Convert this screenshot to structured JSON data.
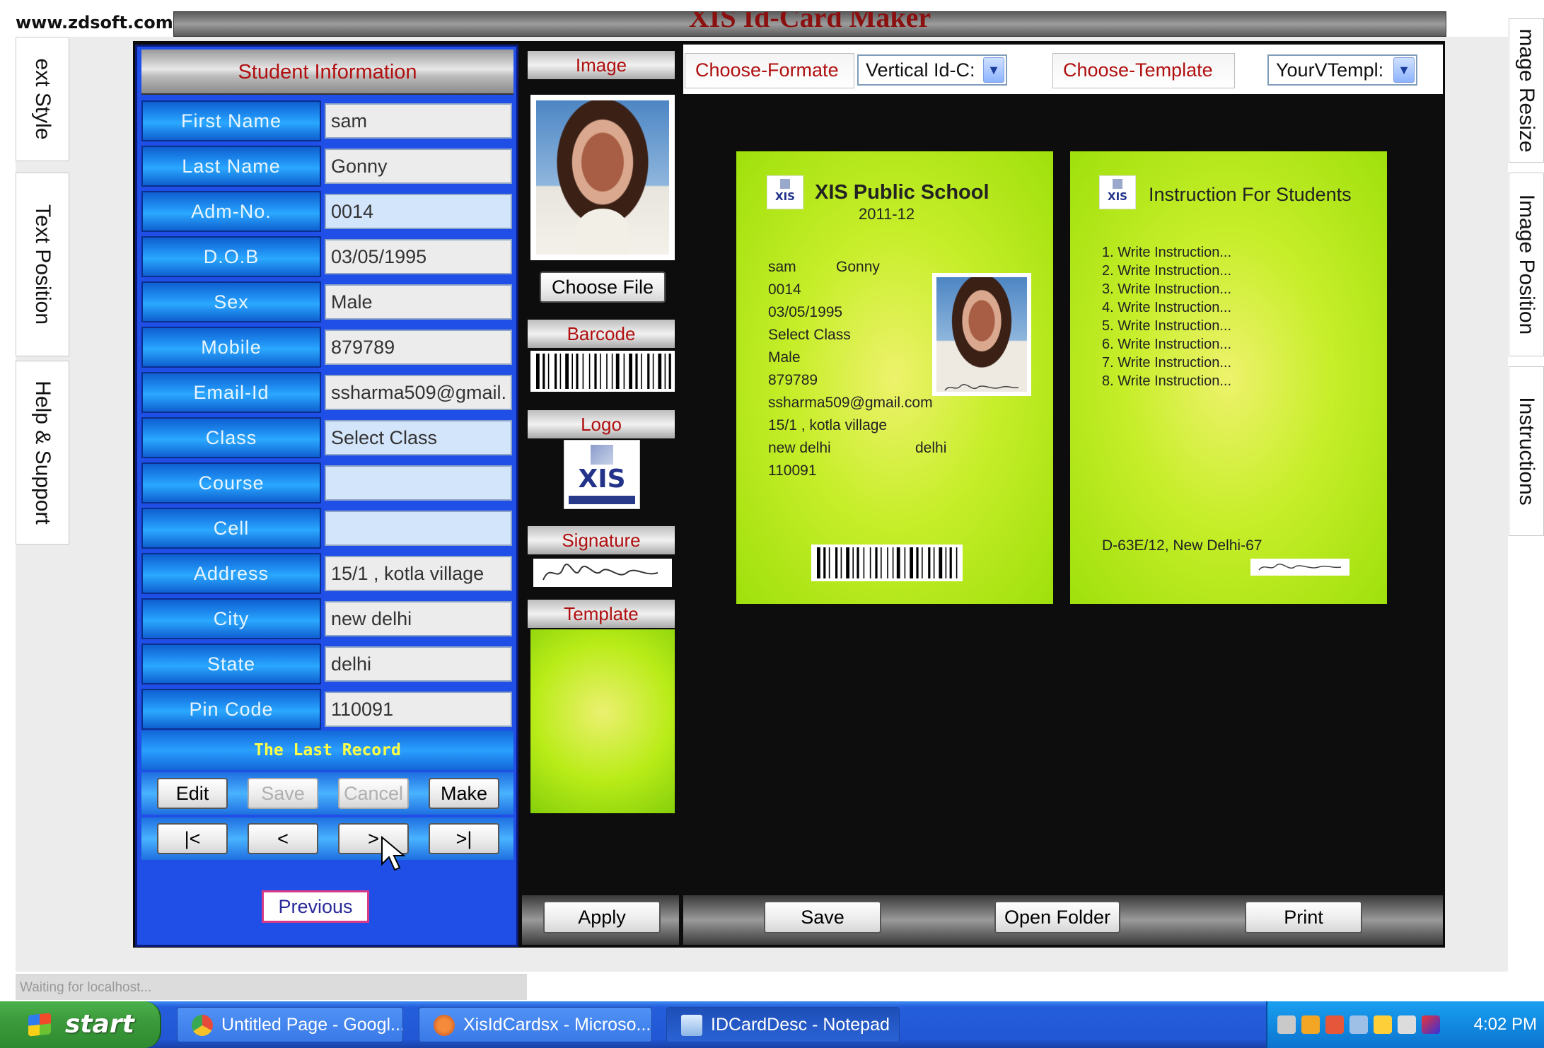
{
  "browser": {
    "url": "www.zdsoft.com",
    "status_text": "Waiting for localhost..."
  },
  "app": {
    "title": "XIS Id-Card Maker"
  },
  "side_tabs": {
    "left": [
      "ext Style",
      "Text Position",
      "Help & Support"
    ],
    "right": [
      "mage Resize",
      "Image Position",
      "Instructions"
    ]
  },
  "student_panel": {
    "header": "Student Information",
    "fields": [
      {
        "label": "First Name",
        "value": "sam",
        "highlight": false
      },
      {
        "label": "Last Name",
        "value": "Gonny",
        "highlight": false
      },
      {
        "label": "Adm-No.",
        "value": "0014",
        "highlight": true
      },
      {
        "label": "D.O.B",
        "value": "03/05/1995",
        "highlight": false
      },
      {
        "label": "Sex",
        "value": "Male",
        "highlight": false
      },
      {
        "label": "Mobile",
        "value": "879789",
        "highlight": false
      },
      {
        "label": "Email-Id",
        "value": "ssharma509@gmail.",
        "highlight": false
      },
      {
        "label": "Class",
        "value": "Select Class",
        "highlight": true
      },
      {
        "label": "Course",
        "value": "",
        "highlight": true
      },
      {
        "label": "Cell",
        "value": "",
        "highlight": true
      },
      {
        "label": "Address",
        "value": "15/1 , kotla village",
        "highlight": false
      },
      {
        "label": "City",
        "value": "new delhi",
        "highlight": false
      },
      {
        "label": "State",
        "value": "delhi",
        "highlight": false
      },
      {
        "label": "Pin Code",
        "value": "110091",
        "highlight": false
      }
    ],
    "record_status": "The Last Record",
    "action_buttons": {
      "edit": "Edit",
      "save": "Save",
      "cancel": "Cancel",
      "make": "Make"
    },
    "nav_buttons": {
      "first": "|<",
      "prev": "<",
      "next": ">",
      "last": ">|"
    },
    "previous_label": "Previous"
  },
  "image_column": {
    "image_header": "Image",
    "choose_file": "Choose File",
    "barcode_header": "Barcode",
    "logo_header": "Logo",
    "logo_text": "XIS",
    "signature_header": "Signature",
    "template_header": "Template"
  },
  "format_bar": {
    "choose_format_label": "Choose-Formate",
    "format_value": "Vertical Id-C:",
    "choose_template_label": "Choose-Template",
    "template_value": "YourVTempl:"
  },
  "front_card": {
    "school_name": "XIS Public School",
    "session": "2011-12",
    "first_name": "sam",
    "last_name": "Gonny",
    "adm_no": "0014",
    "dob": "03/05/1995",
    "class": "Select Class",
    "sex": "Male",
    "mobile": "879789",
    "email": "ssharma509@gmail.com",
    "address": "15/1 , kotla village",
    "city": "new delhi",
    "state": "delhi",
    "pin": "110091"
  },
  "back_card": {
    "title": "Instruction For Students",
    "instructions": [
      "1. Write Instruction...",
      "2. Write Instruction...",
      "3. Write Instruction...",
      "4. Write Instruction...",
      "5. Write Instruction...",
      "6. Write Instruction...",
      "7. Write Instruction...",
      "8. Write Instruction..."
    ],
    "footer_address": "D-63E/12, New Delhi-67"
  },
  "bottom_buttons": {
    "apply": "Apply",
    "save": "Save",
    "open_folder": "Open Folder",
    "print": "Print"
  },
  "taskbar": {
    "start_label": "start",
    "tasks": [
      {
        "label": "Untitled Page - Googl...",
        "icon": "chrome-icon",
        "active": false
      },
      {
        "label": "XisIdCardsx - Microso...",
        "icon": "visual-studio-icon",
        "active": false
      },
      {
        "label": "IDCardDesc - Notepad",
        "icon": "notepad-icon",
        "active": true
      }
    ],
    "clock": "4:02 PM"
  },
  "colors": {
    "panel_blue": "#1f4fe6",
    "label_red": "#b01010",
    "card_green": "#b9ec18",
    "record_yellow": "#ffff44"
  }
}
